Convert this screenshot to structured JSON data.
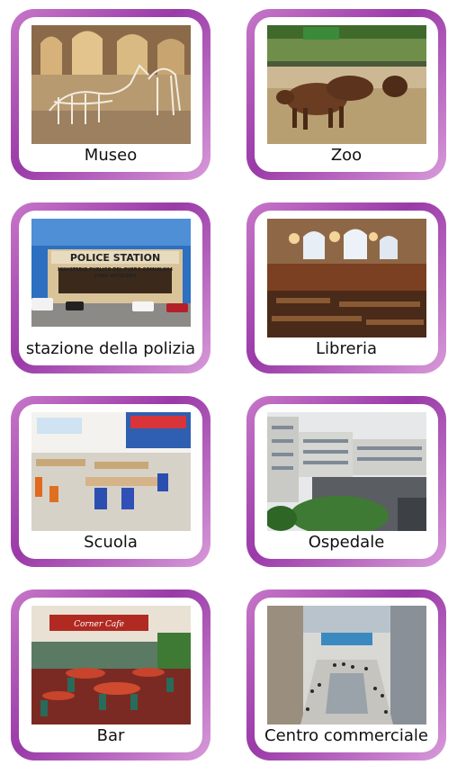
{
  "cards": [
    {
      "label": "Museo",
      "photo": "museum-photo"
    },
    {
      "label": "Zoo",
      "photo": "zoo-photo"
    },
    {
      "label": "stazione della polizia",
      "photo": "police-station-photo"
    },
    {
      "label": "Libreria",
      "photo": "library-photo"
    },
    {
      "label": "Scuola",
      "photo": "school-photo"
    },
    {
      "label": "Ospedale",
      "photo": "hospital-photo"
    },
    {
      "label": "Bar",
      "photo": "bar-photo"
    },
    {
      "label": "Centro commerciale",
      "photo": "mall-photo"
    }
  ],
  "police_sign": {
    "title": "POLICE STATION",
    "line1": "MINISTERIO PUBLICO DEL FUERO COMUN Nº4",
    "line2": "ZONA HOTELERA"
  },
  "bar_sign": "Corner Cafe",
  "colors": {
    "frame_dark": "#9a3aa8",
    "frame_light": "#d89ad9",
    "card_bg": "#ffffff"
  }
}
